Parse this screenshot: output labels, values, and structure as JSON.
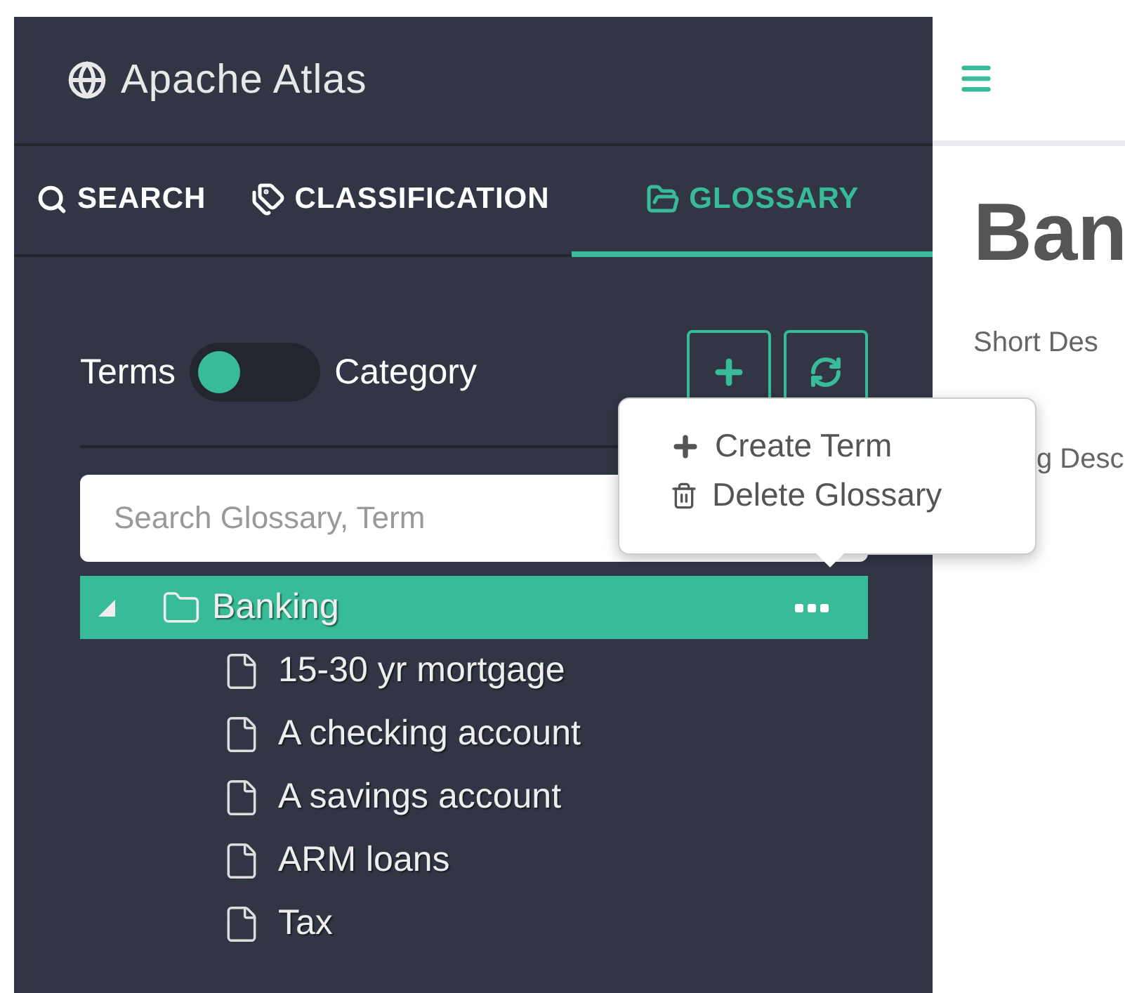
{
  "app": {
    "title": "Apache Atlas"
  },
  "tabs": [
    {
      "label": "SEARCH",
      "kind": "search",
      "selected": false
    },
    {
      "label": "CLASSIFICATION",
      "kind": "tags",
      "selected": false
    },
    {
      "label": "GLOSSARY",
      "kind": "folder",
      "selected": true
    }
  ],
  "view_toggle": {
    "left_label": "Terms",
    "right_label": "Category",
    "on": false
  },
  "actions": [
    {
      "kind": "add"
    },
    {
      "kind": "refresh"
    }
  ],
  "search": {
    "placeholder": "Search Glossary, Term"
  },
  "tree": [
    {
      "label": "Banking",
      "kind": "folder",
      "expanded": true,
      "selected": true,
      "children": [
        {
          "label": "15-30 yr mortgage",
          "kind": "term",
          "selected": false
        },
        {
          "label": "A checking account",
          "kind": "term",
          "selected": false
        },
        {
          "label": "A savings account",
          "kind": "term",
          "selected": false
        },
        {
          "label": "ARM loans",
          "kind": "term",
          "selected": false
        },
        {
          "label": "Tax",
          "kind": "term",
          "selected": false
        }
      ]
    }
  ],
  "menu": {
    "items": [
      {
        "kind": "add",
        "label": "Create Term"
      },
      {
        "kind": "delete",
        "label": "Delete Glossary"
      }
    ]
  },
  "detail": {
    "title": "Ban",
    "fields": [
      "Short Des",
      "g Desc"
    ]
  }
}
